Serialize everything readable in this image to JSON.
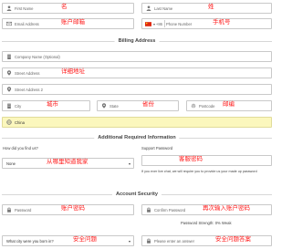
{
  "fields": {
    "first_name": "First Name",
    "last_name": "Last Name",
    "email": "Email Address",
    "country_code": "+86",
    "phone": "Phone Number",
    "company": "Company Name (Optional)",
    "street1": "Street Address",
    "street2": "Street Address 2",
    "city": "City",
    "state": "State",
    "postcode": "Postcode",
    "country": "China",
    "how_find_value": "None",
    "support_password": "",
    "password": "Password",
    "confirm_password": "Confirm Password",
    "security_question": "What city were you born in?",
    "answer": "Please enter an answer"
  },
  "sections": {
    "billing": "Billing Address",
    "additional": "Additional Required Information",
    "security": "Account Security"
  },
  "labels": {
    "how_find": "How did you find us?",
    "support_password": "Support Password",
    "support_help": "If you ever live chat, we will require you to provide us your made up password",
    "strength": "Password Strength: 0% Weak"
  },
  "annotations": {
    "first_name": "名",
    "last_name": "姓",
    "email": "账户邮箱",
    "phone": "手机号",
    "street1": "详细地址",
    "city": "城市",
    "state": "省份",
    "postcode": "邮编",
    "how_find": "从哪里知道我家",
    "support_password": "客服密码",
    "password": "账户密码",
    "confirm_password": "再次输入账户密码",
    "security_question": "安全问题",
    "answer": "安全问题答案"
  },
  "colors": {
    "country_bg": "#fbf7bd",
    "annotation": "#ff1a1a",
    "field_border": "#c9c9c9"
  },
  "icons": {
    "user": "user-icon",
    "email": "envelope-icon",
    "building": "building-icon",
    "map": "map-pin-icon",
    "globe": "globe-icon",
    "lock": "lock-icon",
    "flag": "china-flag-icon"
  }
}
